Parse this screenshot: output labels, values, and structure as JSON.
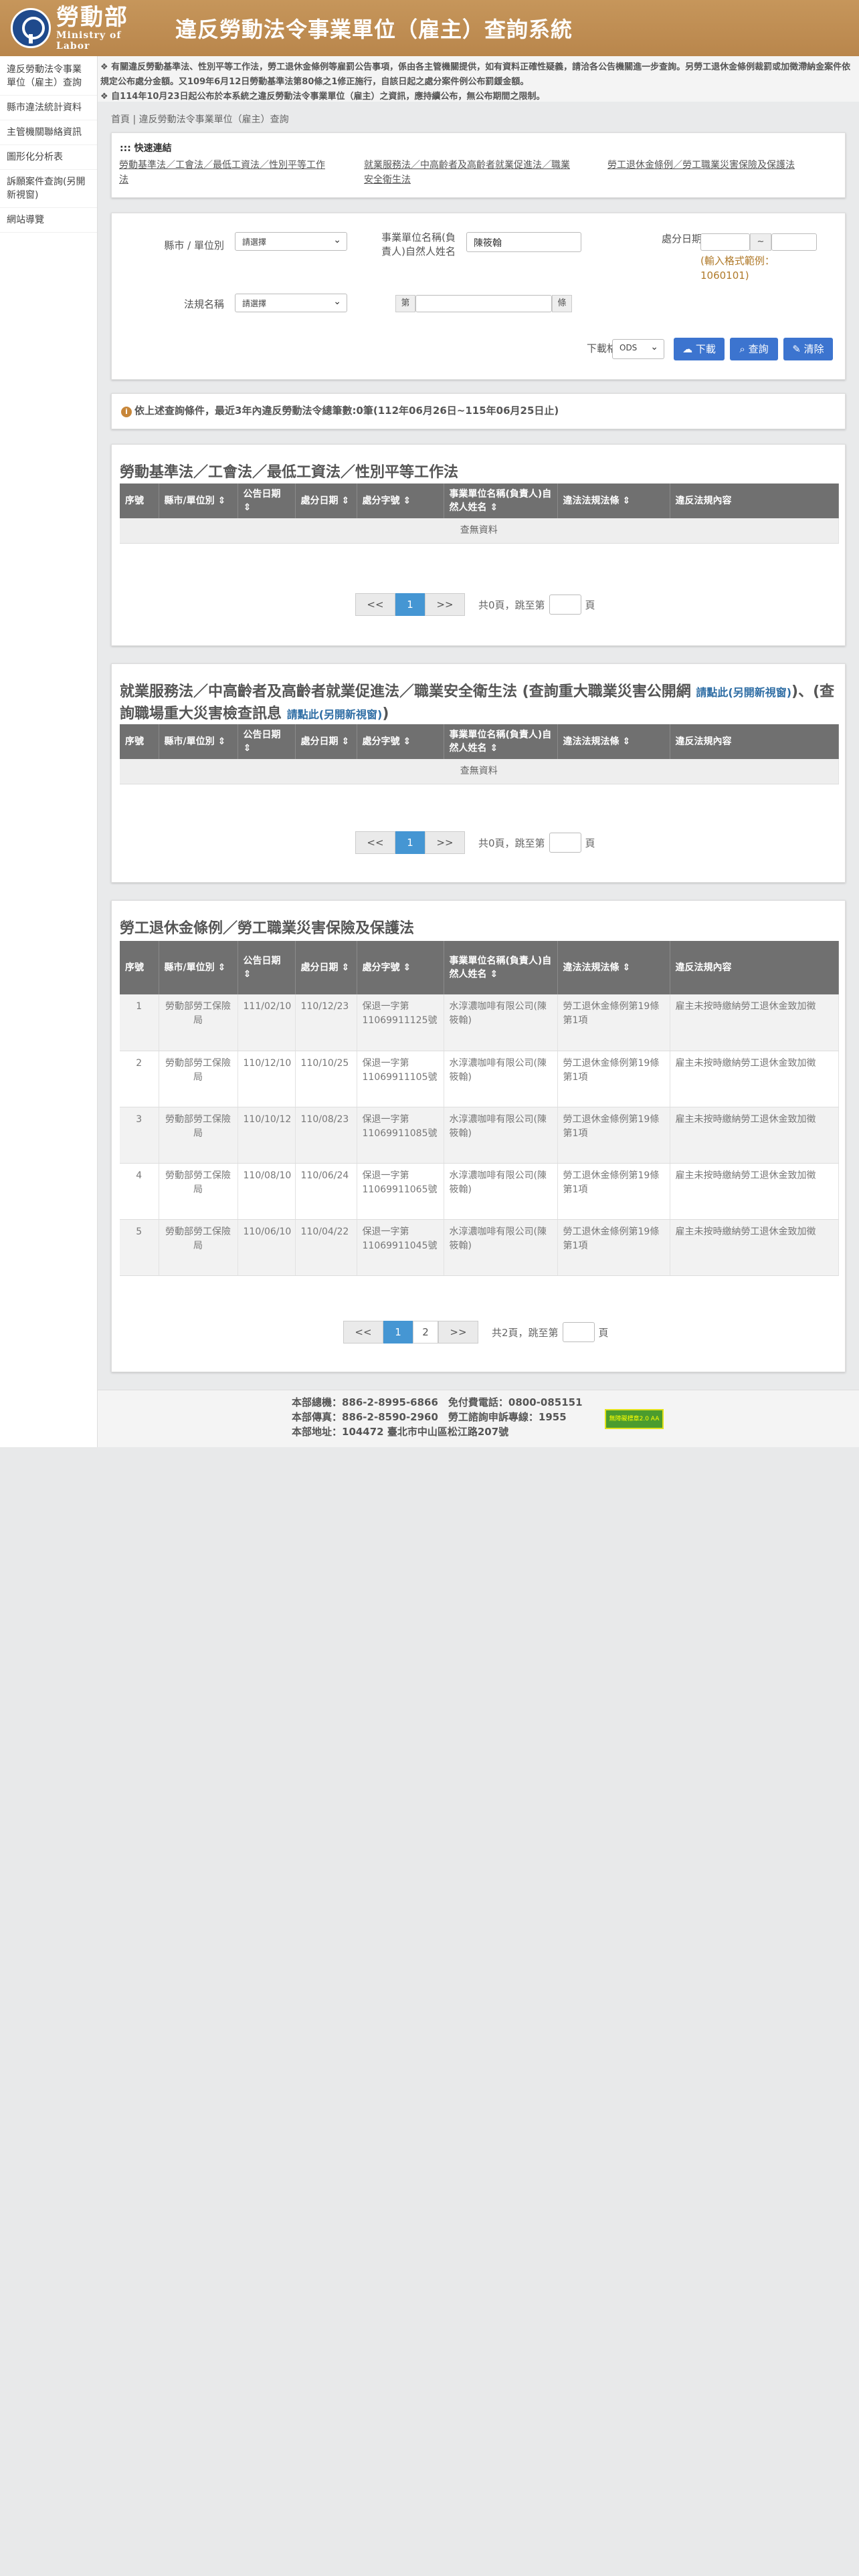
{
  "header": {
    "logo_zh": "勞動部",
    "logo_en": "Ministry of Labor",
    "title": "違反勞動法令事業單位（雇主）查詢系統"
  },
  "notice": [
    "❖ 有關違反勞動基準法、性別平等工作法，勞工退休金條例等雇罰公告事項，係由各主管機關提供，如有資料正確性疑義，請洽各公告機關進一步查詢。另勞工退休金條例裁罰或加徵滯納金案件依規定公布處分金額。又109年6月12日勞動基準法第80條之1修正施行，自該日起之處分案件例公布罰鍰金額。",
    "❖ 自114年10月23日起公布於本系統之違反勞動法令事業單位（雇主）之資訊，應持續公布，無公布期間之限制。"
  ],
  "sidebar": {
    "items": [
      {
        "label": "違反勞動法令事業單位（雇主）查詢"
      },
      {
        "label": "縣市違法統計資料"
      },
      {
        "label": "主管機關聯絡資訊"
      },
      {
        "label": "圖形化分析表"
      },
      {
        "label": "訴願案件查詢(另開新視窗)"
      },
      {
        "label": "網站導覽"
      }
    ]
  },
  "breadcrumb": "首頁 | 違反勞動法令事業單位（雇主）查詢",
  "quick": {
    "title": ":::  快速連結",
    "links": [
      {
        "label": "勞動基準法／工會法／最低工資法／性別平等工作法"
      },
      {
        "label": "就業服務法／中高齡者及高齡者就業促進法／職業安全衛生法"
      },
      {
        "label": "勞工退休金條例／勞工職業災害保險及保護法"
      }
    ]
  },
  "search": {
    "county_label": "縣市 / 單位別",
    "county_value": "請選擇",
    "employer_label": "事業單位名稱(負責人)自然人姓名",
    "employer_value": "陳筱翰",
    "date_label": "處分日期",
    "date_sep": "~",
    "date_hint": "(輸入格式範例：1060101)",
    "law_label": "法規名稱",
    "law_value": "請選擇",
    "article_prefix": "第",
    "article_suffix": "條",
    "format_label": "下載格式",
    "format_value": "ODS",
    "download_label": "下載",
    "query_label": "查詢",
    "clear_label": "清除"
  },
  "info": {
    "text": "依上述查詢條件，最近3年內違反勞動法令總筆數:0筆(112年06月26日~115年06月25日止)"
  },
  "colors": {
    "header": "#b9864c",
    "accent": "#3c74cf",
    "table_head": "#707070",
    "pager_active": "#4596d3"
  },
  "section1": {
    "title": "勞動基準法／工會法／最低工資法／性別平等工作法",
    "headers": [
      "序號",
      "縣市/單位別 ⇕",
      "公告日期 ⇕",
      "處分日期 ⇕",
      "處分字號 ⇕",
      "事業單位名稱(負責人)自然人姓名 ⇕",
      "違法法規法條 ⇕",
      "違反法規內容"
    ],
    "empty": "查無資料",
    "pager": {
      "prev": "<<",
      "current": "1",
      "next": ">>",
      "summary": "共0頁，跳至第",
      "suffix": "頁"
    }
  },
  "section2": {
    "title": "就業服務法／中高齡者及高齡者就業促進法／職業安全衛生法 (查詢重大職業災害公開網",
    "link1": "請點此(另開新視窗)",
    "middle": ")、(查詢職場重大災害檢查訊息",
    "link2": "請點此(另開新視窗)",
    "end": ")",
    "headers": [
      "序號",
      "縣市/單位別 ⇕",
      "公告日期 ⇕",
      "處分日期 ⇕",
      "處分字號 ⇕",
      "事業單位名稱(負責人)自然人姓名 ⇕",
      "違法法規法條 ⇕",
      "違反法規內容"
    ],
    "empty": "查無資料",
    "pager": {
      "prev": "<<",
      "current": "1",
      "next": ">>",
      "summary": "共0頁，跳至第",
      "suffix": "頁"
    }
  },
  "section3": {
    "title": "勞工退休金條例／勞工職業災害保險及保護法",
    "headers": [
      "序號",
      "縣市/單位別 ⇕",
      "公告日期 ⇕",
      "處分日期 ⇕",
      "處分字號 ⇕",
      "事業單位名稱(負責人)自然人姓名 ⇕",
      "違法法規法條 ⇕",
      "違反法規內容"
    ],
    "rows": [
      [
        "1",
        "勞動部勞工保險局",
        "111/02/10",
        "110/12/23",
        "保退一字第11069911125號",
        "水淳濃咖啡有限公司(陳筱翰)",
        "勞工退休金條例第19條第1項",
        "雇主未按時繳納勞工退休金致加徵"
      ],
      [
        "2",
        "勞動部勞工保險局",
        "110/12/10",
        "110/10/25",
        "保退一字第11069911105號",
        "水淳濃咖啡有限公司(陳筱翰)",
        "勞工退休金條例第19條第1項",
        "雇主未按時繳納勞工退休金致加徵"
      ],
      [
        "3",
        "勞動部勞工保險局",
        "110/10/12",
        "110/08/23",
        "保退一字第11069911085號",
        "水淳濃咖啡有限公司(陳筱翰)",
        "勞工退休金條例第19條第1項",
        "雇主未按時繳納勞工退休金致加徵"
      ],
      [
        "4",
        "勞動部勞工保險局",
        "110/08/10",
        "110/06/24",
        "保退一字第11069911065號",
        "水淳濃咖啡有限公司(陳筱翰)",
        "勞工退休金條例第19條第1項",
        "雇主未按時繳納勞工退休金致加徵"
      ],
      [
        "5",
        "勞動部勞工保險局",
        "110/06/10",
        "110/04/22",
        "保退一字第11069911045號",
        "水淳濃咖啡有限公司(陳筱翰)",
        "勞工退休金條例第19條第1項",
        "雇主未按時繳納勞工退休金致加徵"
      ]
    ],
    "pager": {
      "prev": "<<",
      "current": "1",
      "page2": "2",
      "next": ">>",
      "summary": "共2頁，跳至第",
      "suffix": "頁"
    }
  },
  "footer": {
    "line1": "本部總機：886-2-8995-6866　免付費電話：0800-085151",
    "line2": "本部傳真：886-2-8590-2960　勞工諮詢申訴專線：1955",
    "line3": "本部地址：104472 臺北市中山區松江路207號",
    "badge": "無障礙標章2.0 AA"
  }
}
